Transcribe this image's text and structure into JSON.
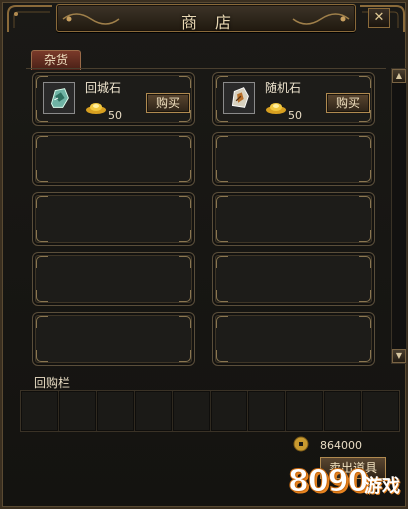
{
  "window": {
    "title": "商店",
    "close_label": "✕"
  },
  "tabs": [
    {
      "label": "杂货",
      "active": true
    }
  ],
  "items": [
    {
      "name": "回城石",
      "price": "50",
      "buy_label": "购买",
      "icon": "return-stone-icon"
    },
    {
      "name": "随机石",
      "price": "50",
      "buy_label": "购买",
      "icon": "random-stone-icon"
    }
  ],
  "currency_icon": "gold-ingot-icon",
  "buyback": {
    "label": "回购栏",
    "slots": 10
  },
  "gold": {
    "icon": "coin-icon",
    "amount": "864000"
  },
  "sell_button_label": "卖出道具",
  "watermark": {
    "brand": "8090",
    "suffix": "游戏"
  },
  "colors": {
    "accent": "#b08a50",
    "panel": "#1a1916",
    "tab": "#7a3a2a",
    "watermark": "#e88420"
  }
}
